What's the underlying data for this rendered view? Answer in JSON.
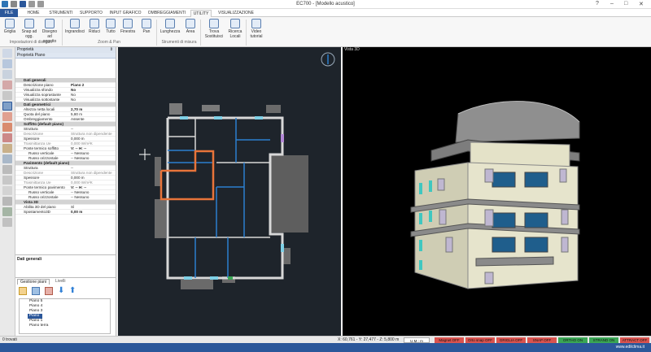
{
  "title": "EC700 - [Modello acustico]",
  "tabs": [
    "FILE",
    "HOME",
    "STRUMENTI",
    "SUPPORTO",
    "INPUT GRAFICO",
    "OMBREGGIAMENTI",
    "UTILITY",
    "VISUALIZZAZIONE"
  ],
  "ribbon": {
    "buttons": [
      "Griglia",
      "Snap ad ogg.",
      "Disegno ad oggetto",
      "Ingrandisci",
      "Riduci",
      "Tutto",
      "Finestra",
      "Pan",
      "Lunghezza",
      "Area",
      "Trova Sostituisci",
      "Ricerca Locali",
      "Video tutorial"
    ],
    "groups": [
      "Impostazioni di disegno",
      "Zoom & Pan",
      "Strumenti di misura"
    ]
  },
  "panel": {
    "title": "Proprietà",
    "subtitle": "Proprietà Piano",
    "pin": "⇕"
  },
  "props": [
    {
      "k": "Dati generali",
      "sec": true
    },
    {
      "k": "Descrizione piano",
      "v": "Piano 2",
      "bold": true
    },
    {
      "k": "Visualizza sfondo",
      "v": "No",
      "bold": true
    },
    {
      "k": "Visualizza soprastante",
      "v": "No"
    },
    {
      "k": "Visualizza sottostante",
      "v": "No"
    },
    {
      "k": "Dati geometrici",
      "sec": true
    },
    {
      "k": "Altezza netta locali",
      "v": "2,70 m",
      "bold": true
    },
    {
      "k": "Quota del piano",
      "v": "5,80 m"
    },
    {
      "k": "Ombreggiamento",
      "v": "Assente"
    },
    {
      "k": "Soffitto (default piano)",
      "sec": true
    },
    {
      "k": "Struttura",
      "v": "--"
    },
    {
      "k": "Descrizione",
      "v": "Struttura non dipendente",
      "dim": true
    },
    {
      "k": "Spessore",
      "v": "0,000 m"
    },
    {
      "k": "Trasmittanza Ue",
      "v": "0,000 W/m²K",
      "dim": true
    },
    {
      "k": "Ponte termico soffitto",
      "v": "V: -- H: --",
      "bold": true
    },
    {
      "k": "Russo verticale",
      "v": "-- Nessuno",
      "indent": true
    },
    {
      "k": "Russo orizzontale",
      "v": "-- Nessuno",
      "indent": true
    },
    {
      "k": "Pavimento (default piano)",
      "sec": true
    },
    {
      "k": "Struttura",
      "v": "--"
    },
    {
      "k": "Descrizione",
      "v": "Struttura non dipendente",
      "dim": true
    },
    {
      "k": "Spessore",
      "v": "0,000 m"
    },
    {
      "k": "Trasmittanza Ue",
      "v": "0,000 W/m²K",
      "dim": true
    },
    {
      "k": "Ponte termico pavimento",
      "v": "V: -- H: --",
      "bold": true
    },
    {
      "k": "Russo verticale",
      "v": "-- Nessuno",
      "indent": true
    },
    {
      "k": "Russo orizzontale",
      "v": "-- Nessuno",
      "indent": true
    },
    {
      "k": "Vista 3D",
      "sec": true
    },
    {
      "k": "Abilita 3D del piano",
      "v": "Sì"
    },
    {
      "k": "Spostamento3D",
      "v": "0,00 m",
      "bold": true
    }
  ],
  "desc": {
    "title": "Dati generali"
  },
  "plans": {
    "tabs": [
      "Gestione piani",
      "Livelli"
    ],
    "items": [
      "Piano 5",
      "Piano 4",
      "Piano 3",
      "Piano 2",
      "Piano 1",
      "Piano terra"
    ],
    "selected": "Piano 2"
  },
  "view3d": {
    "label": "Vista 3D"
  },
  "status": {
    "left": "0 trovati",
    "coords": "X: 60,761 - Y: 27,477 - Z: 5,800 m",
    "units": "U.M.: m",
    "toggles": [
      {
        "label": "Magnet OFF",
        "color": "#d9534f"
      },
      {
        "label": "Orto snap OFF",
        "color": "#d9534f"
      },
      {
        "label": "GRIGLIA OFF",
        "color": "#d9534f"
      },
      {
        "label": "SNAP OFF",
        "color": "#d9534f"
      },
      {
        "label": "ORTHO ON",
        "color": "#3aa655"
      },
      {
        "label": "STRAND ON",
        "color": "#3aa655"
      },
      {
        "label": "ATTRACT OFF",
        "color": "#d9534f"
      }
    ]
  },
  "footer": {
    "url": "www.edilclima.it"
  }
}
